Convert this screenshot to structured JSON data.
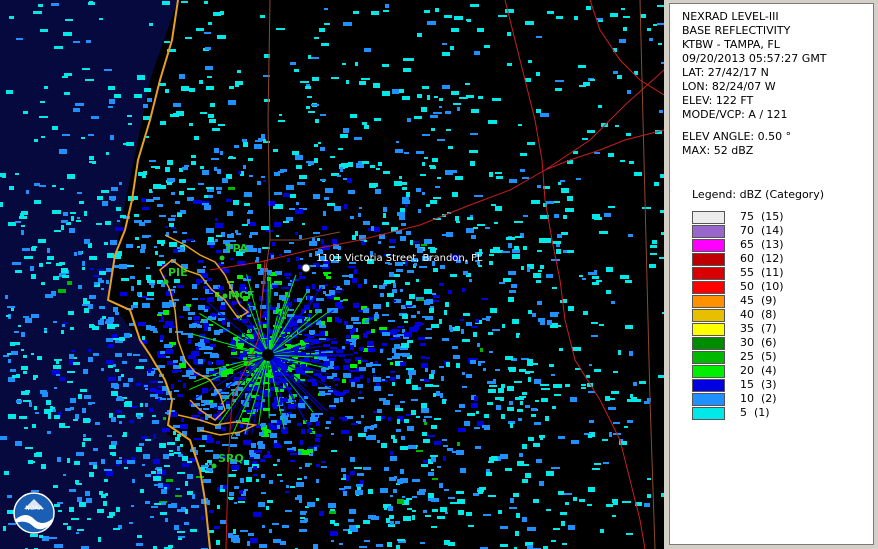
{
  "map": {
    "city_labels": [
      {
        "id": "tpa",
        "text": "TPA"
      },
      {
        "id": "pie",
        "text": "PIE"
      },
      {
        "id": "mcf",
        "text": "MCF"
      },
      {
        "id": "srq",
        "text": "SRQ"
      }
    ],
    "location_label": "1101 Victoria Street, Brandon, FL",
    "logo_text": "NOAA",
    "colors": {
      "background_sea": "#06093d",
      "land": "#000000",
      "coastline": "#e8a020",
      "roads": "#c81e1e",
      "county_lines": "#a0522d"
    }
  },
  "info": {
    "lines": [
      "NEXRAD LEVEL-III",
      "BASE REFLECTIVITY",
      "KTBW - TAMPA, FL",
      "09/20/2013 05:57:27 GMT",
      "LAT: 27/42/17 N",
      "LON: 82/24/07 W",
      "ELEV: 122 FT",
      "MODE/VCP: A / 121"
    ],
    "elev_angle": "ELEV ANGLE: 0.50 °",
    "max": "MAX: 52 dBZ"
  },
  "legend": {
    "title": "Legend: dBZ (Category)",
    "entries": [
      {
        "label": "75  (15)",
        "color": "#ececec"
      },
      {
        "label": "70  (14)",
        "color": "#9966cc"
      },
      {
        "label": "65  (13)",
        "color": "#ff00ff"
      },
      {
        "label": "60  (12)",
        "color": "#c00000"
      },
      {
        "label": "55  (11)",
        "color": "#d80000"
      },
      {
        "label": "50  (10)",
        "color": "#ff0000"
      },
      {
        "label": "45  (9)",
        "color": "#ff9000"
      },
      {
        "label": "40  (8)",
        "color": "#e6c000"
      },
      {
        "label": "35  (7)",
        "color": "#ffff00"
      },
      {
        "label": "30  (6)",
        "color": "#008c00"
      },
      {
        "label": "25  (5)",
        "color": "#00b800"
      },
      {
        "label": "20  (4)",
        "color": "#00ee00"
      },
      {
        "label": "15  (3)",
        "color": "#0000e0"
      },
      {
        "label": "10  (2)",
        "color": "#1e90ff"
      },
      {
        "label": "5  (1)",
        "color": "#00e8e8"
      }
    ]
  }
}
